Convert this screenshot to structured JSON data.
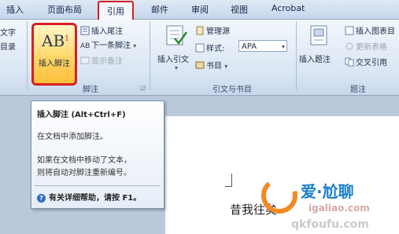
{
  "tabs": [
    "插入",
    "页面布局",
    "引用",
    "邮件",
    "审阅",
    "视图",
    "Acrobat"
  ],
  "active_tab": "引用",
  "ribbon": {
    "left_partial": {
      "line1": "文字",
      "line2": "目录"
    },
    "footnote_group": {
      "label": "脚注",
      "insert_footnote": "插入脚注",
      "insert_endnote": "插入尾注",
      "next_footnote": "下一条脚注",
      "show_notes": "显示备注",
      "big_glyph": "AB",
      "big_sup": "1"
    },
    "citation_group": {
      "label": "引文与书目",
      "manage_sources": "管理源",
      "insert_citation": "插入引文",
      "style_label": "样式:",
      "style_value": "APA",
      "bibliography": "书目"
    },
    "caption_group": {
      "label": "题注",
      "insert_caption": "插入题注",
      "insert_table_of_figures": "插入图表目",
      "update_table": "更新表格",
      "cross_reference": "交叉引用"
    }
  },
  "tooltip": {
    "title": "插入脚注 (Alt+Ctrl+F)",
    "line1": "在文档中添加脚注。",
    "line2": "如果在文档中移动了文本，",
    "line3": "则将自动对脚注重新编号。",
    "help": "有关详细帮助，请按 F1。"
  },
  "document": {
    "text": "昔我往矣"
  },
  "watermark": {
    "brand": "爱·尬聊",
    "site1": "igaliao.com",
    "site2": "qkfoufu.com"
  },
  "colors": {
    "highlight": "#d62020",
    "ribbon_bg": "#dae6f3",
    "tab_text": "#15284a"
  }
}
